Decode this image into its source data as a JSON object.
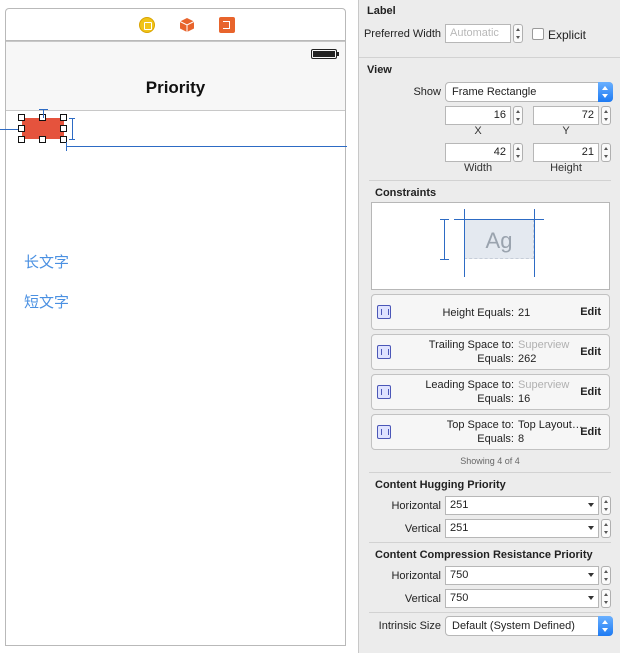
{
  "canvas": {
    "nav_title": "Priority",
    "long_text_label": "长文字",
    "short_text_label": "短文字",
    "dock_icons": [
      "view-controller-icon",
      "first-responder-cube-icon",
      "exit-icon"
    ]
  },
  "inspector": {
    "label_section": {
      "title": "Label",
      "preferred_width_label": "Preferred Width",
      "preferred_width_placeholder": "Automatic",
      "explicit_label": "Explicit",
      "explicit_checked": false
    },
    "view_section": {
      "title": "View",
      "show_label": "Show",
      "show_value": "Frame Rectangle",
      "x_value": "16",
      "y_value": "72",
      "x_label": "X",
      "y_label": "Y",
      "width_value": "42",
      "height_value": "21",
      "width_label": "Width",
      "height_label": "Height"
    },
    "constraints_section": {
      "title": "Constraints",
      "preview_text": "Ag",
      "items": [
        {
          "line1_label": "Height Equals:",
          "line1_value": "21",
          "line2_label": "",
          "line2_value": "",
          "edit": "Edit"
        },
        {
          "line1_label": "Trailing Space to:",
          "line1_value": "Superview",
          "line2_label": "Equals:",
          "line2_value": "262",
          "edit": "Edit"
        },
        {
          "line1_label": "Leading Space to:",
          "line1_value": "Superview",
          "line2_label": "Equals:",
          "line2_value": "16",
          "edit": "Edit"
        },
        {
          "line1_label": "Top Space to:",
          "line1_value": "Top Layout…",
          "line2_label": "Equals:",
          "line2_value": "8",
          "edit": "Edit"
        }
      ],
      "showing": "Showing 4 of 4"
    },
    "hugging_section": {
      "title": "Content Hugging Priority",
      "horizontal_label": "Horizontal",
      "horizontal_value": "251",
      "vertical_label": "Vertical",
      "vertical_value": "251"
    },
    "compression_section": {
      "title": "Content Compression Resistance Priority",
      "horizontal_label": "Horizontal",
      "horizontal_value": "750",
      "vertical_label": "Vertical",
      "vertical_value": "750"
    },
    "intrinsic": {
      "label": "Intrinsic Size",
      "value": "Default (System Defined)"
    }
  },
  "colors": {
    "selected_label_fill": "#e5533d",
    "text_link_blue": "#4a90e2",
    "guide_blue": "#2d6bc4",
    "popup_accent": "#1d7af3"
  }
}
